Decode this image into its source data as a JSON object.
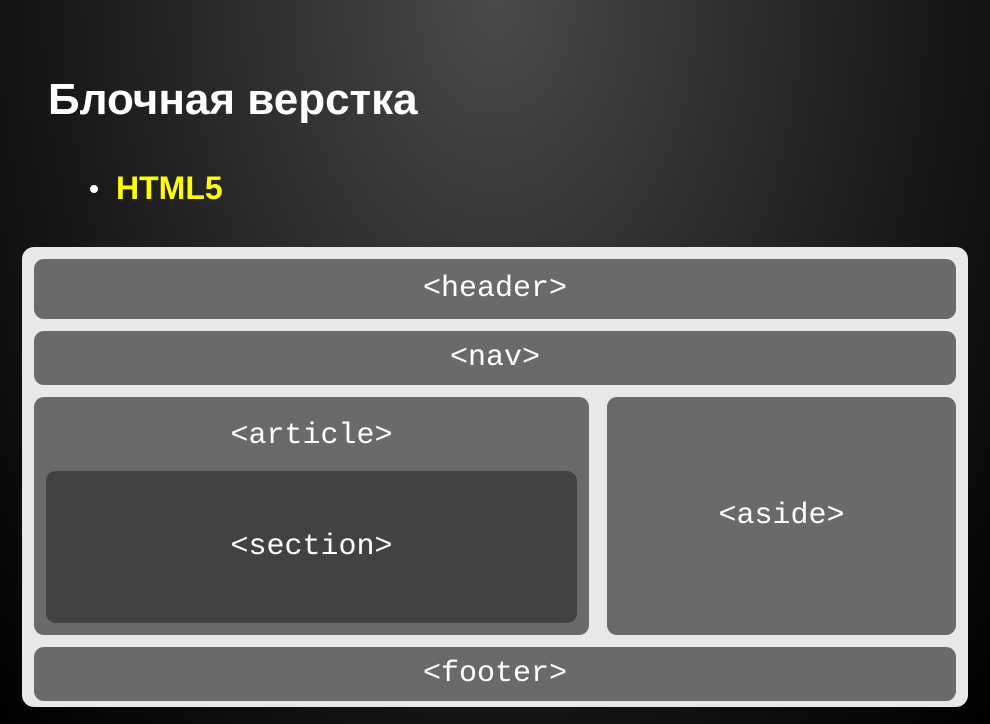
{
  "title": "Блочная верстка",
  "bullet": {
    "text": "HTML5"
  },
  "diagram": {
    "header": "<header>",
    "nav": "<nav>",
    "article": "<article>",
    "section": "<section>",
    "aside": "<aside>",
    "footer": "<footer>"
  }
}
